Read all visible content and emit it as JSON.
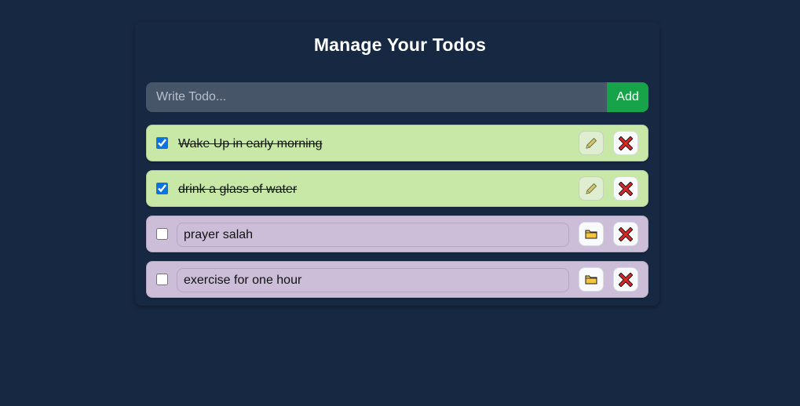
{
  "header": {
    "title": "Manage Your Todos"
  },
  "add_form": {
    "placeholder": "Write Todo...",
    "value": "",
    "add_label": "Add"
  },
  "todos": [
    {
      "text": "Wake Up in early morning",
      "completed": true
    },
    {
      "text": "drink a glass of water",
      "completed": true
    },
    {
      "text": "prayer salah",
      "completed": false
    },
    {
      "text": "exercise for one hour",
      "completed": false
    }
  ],
  "icons": {
    "edit_completed": "pencil-icon",
    "edit_pending": "folder-icon",
    "delete": "cross-mark-icon"
  },
  "colors": {
    "background": "#172842",
    "input_bg": "#475569",
    "add_button": "#16a34a",
    "completed_row": "#c8e8a8",
    "pending_row": "#ccbed9",
    "delete_icon": "#dc2626"
  }
}
